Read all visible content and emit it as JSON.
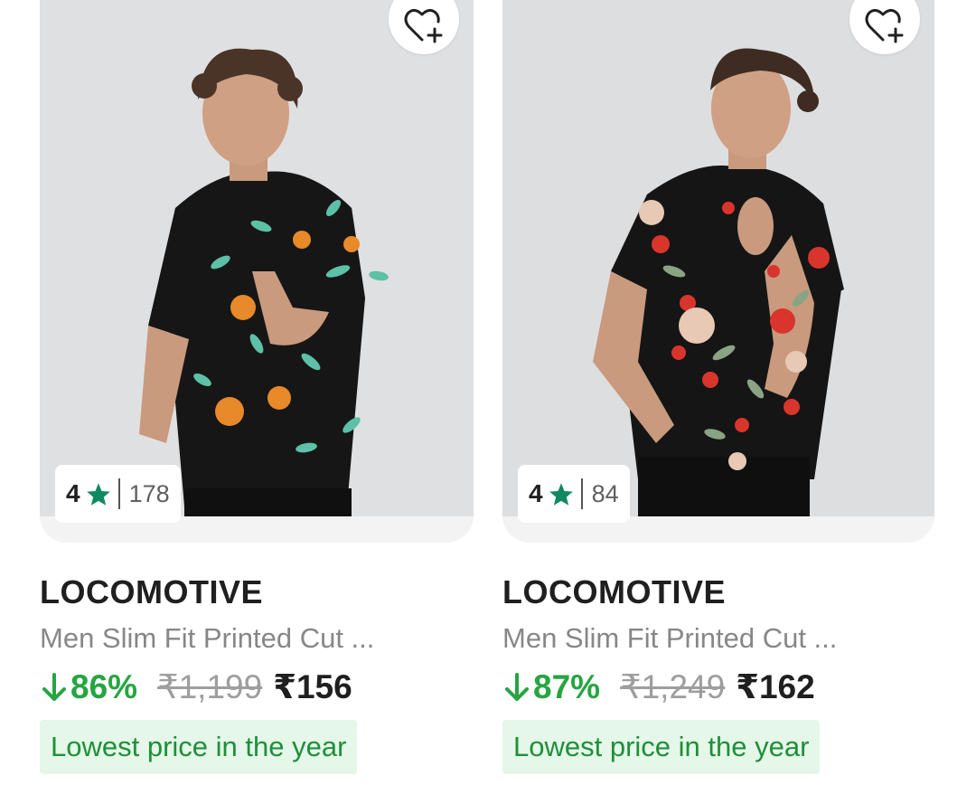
{
  "colors": {
    "discount_green": "#26a541",
    "tag_bg": "#e4f7e8",
    "tag_text": "#1f8f3a",
    "star_green": "#0f8a5f"
  },
  "products": [
    {
      "brand": "LOCOMOTIVE",
      "title": "Men Slim Fit Printed Cut ...",
      "rating": "4",
      "rating_count": "178",
      "discount": "86%",
      "mrp": "₹1,199",
      "price": "₹156",
      "offer_tag": "Lowest price in the year",
      "wishlist_icon": "heart-plus-icon",
      "image": "man-in-black-floral-shirt-orange-teal"
    },
    {
      "brand": "LOCOMOTIVE",
      "title": "Men Slim Fit Printed Cut ...",
      "rating": "4",
      "rating_count": "84",
      "discount": "87%",
      "mrp": "₹1,249",
      "price": "₹162",
      "offer_tag": "Lowest price in the year",
      "wishlist_icon": "heart-plus-icon",
      "image": "man-in-black-floral-shirt-red-rose"
    }
  ]
}
